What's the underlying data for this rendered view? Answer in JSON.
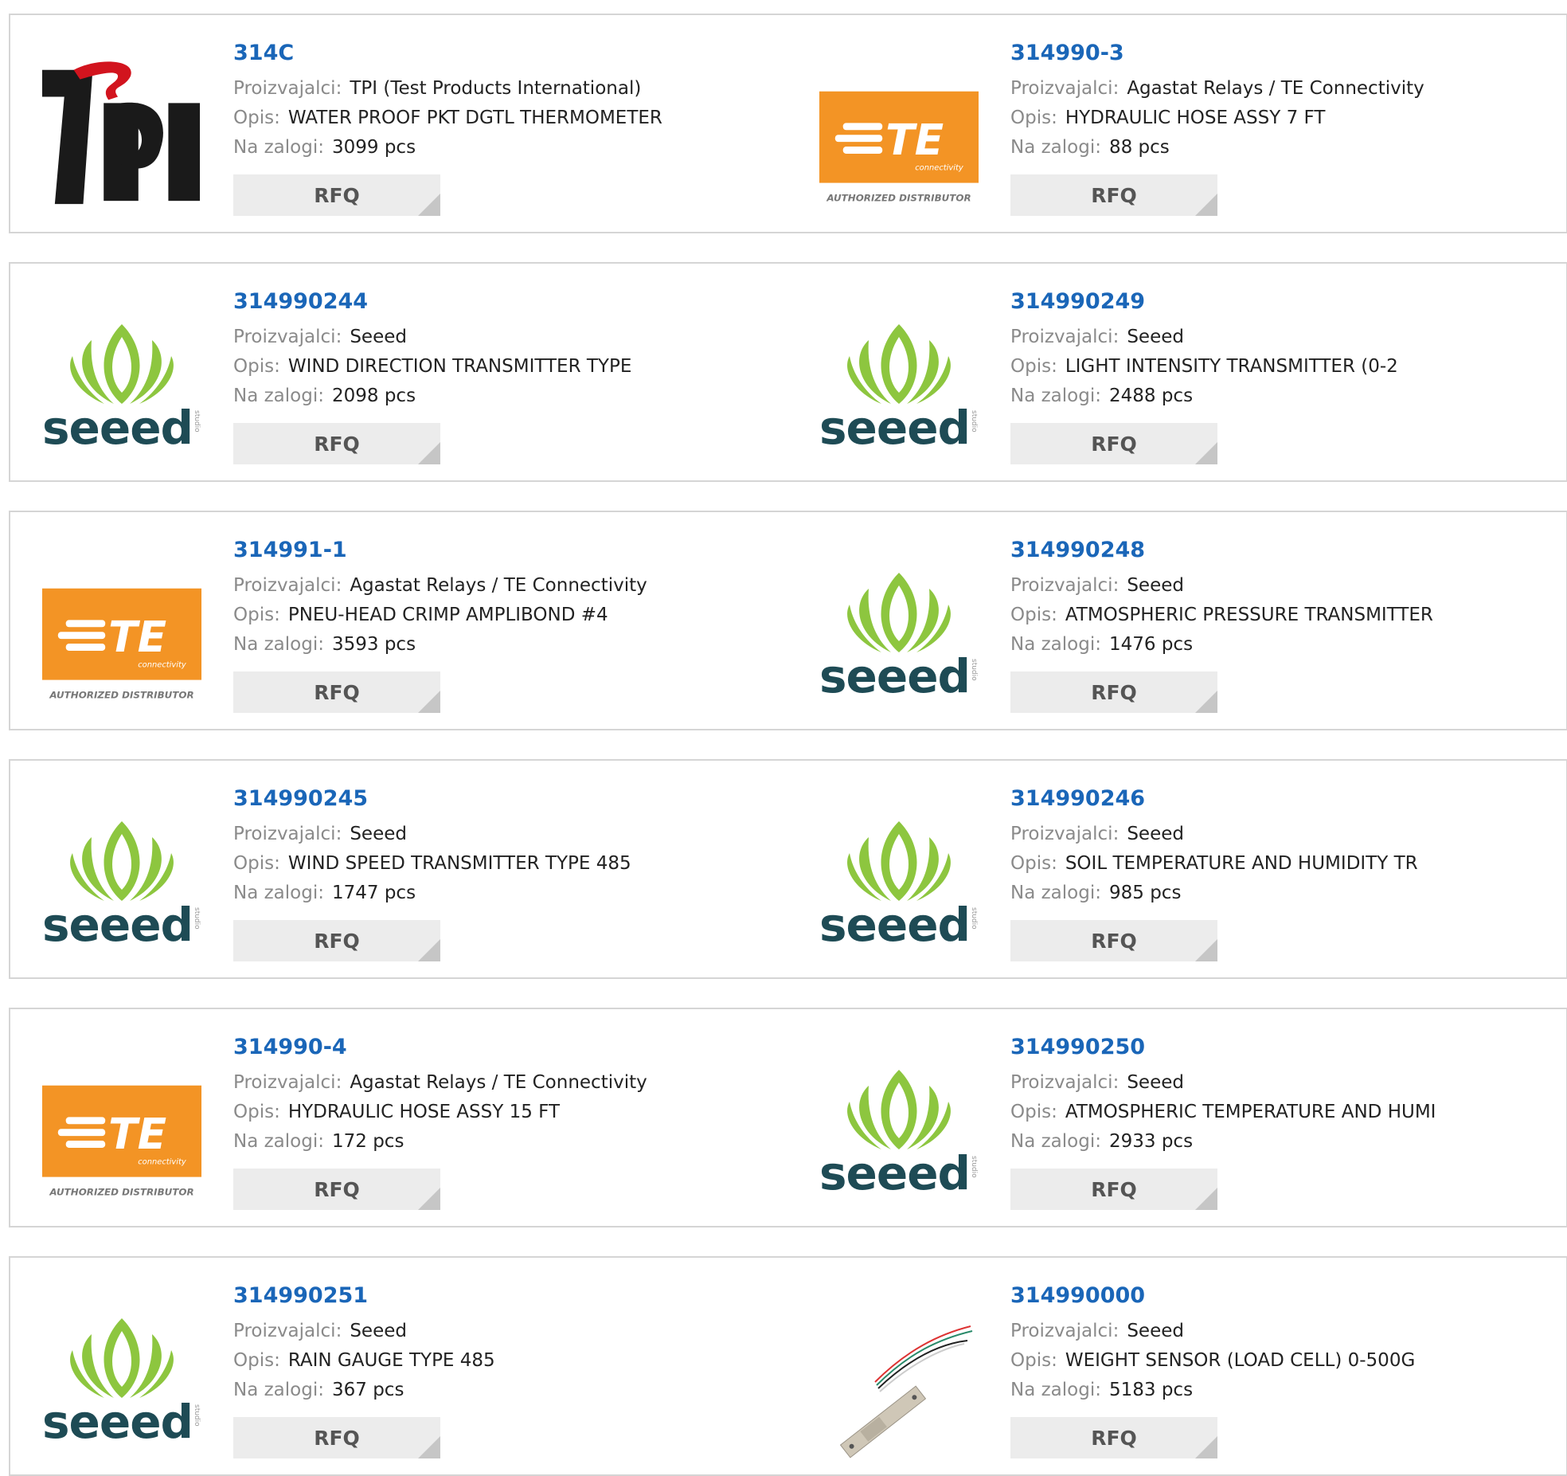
{
  "labels": {
    "manufacturer": "Proizvajalci:",
    "description": "Opis:",
    "stock": "Na zalogi:",
    "rfq": "RFQ"
  },
  "brand_logos": {
    "te_caption": "AUTHORIZED DISTRIBUTOR",
    "te_word": "TE",
    "te_sub": "connectivity",
    "seeed_word": "seeed",
    "seeed_side": "studio",
    "tpi_word": "tpi"
  },
  "colors": {
    "part_link": "#1a66b8",
    "te_orange": "#f39425",
    "seeed_green": "#8dc63f",
    "seeed_text": "#1e4b55",
    "tpi_red": "#d2141e",
    "tpi_black": "#1a1a1a"
  },
  "products": [
    {
      "part": "314C",
      "manufacturer": "TPI (Test Products International)",
      "description": "WATER PROOF PKT DGTL THERMOMETER",
      "stock": "3099 pcs",
      "logo": "tpi-logo"
    },
    {
      "part": "314990-3",
      "manufacturer": "Agastat Relays / TE Connectivity",
      "description": "HYDRAULIC HOSE ASSY 7 FT",
      "stock": "88 pcs",
      "logo": "te-logo"
    },
    {
      "part": "314990244",
      "manufacturer": "Seeed",
      "description": "WIND DIRECTION TRANSMITTER TYPE",
      "stock": "2098 pcs",
      "logo": "seeed-logo"
    },
    {
      "part": "314990249",
      "manufacturer": "Seeed",
      "description": "LIGHT INTENSITY TRANSMITTER (0-2",
      "stock": "2488 pcs",
      "logo": "seeed-logo"
    },
    {
      "part": "314991-1",
      "manufacturer": "Agastat Relays / TE Connectivity",
      "description": "PNEU-HEAD CRIMP AMPLIBOND #4",
      "stock": "3593 pcs",
      "logo": "te-logo"
    },
    {
      "part": "314990248",
      "manufacturer": "Seeed",
      "description": "ATMOSPHERIC PRESSURE TRANSMITTER",
      "stock": "1476 pcs",
      "logo": "seeed-logo"
    },
    {
      "part": "314990245",
      "manufacturer": "Seeed",
      "description": "WIND SPEED TRANSMITTER TYPE 485",
      "stock": "1747 pcs",
      "logo": "seeed-logo"
    },
    {
      "part": "314990246",
      "manufacturer": "Seeed",
      "description": "SOIL TEMPERATURE AND HUMIDITY TR",
      "stock": "985 pcs",
      "logo": "seeed-logo"
    },
    {
      "part": "314990-4",
      "manufacturer": "Agastat Relays / TE Connectivity",
      "description": "HYDRAULIC HOSE ASSY 15 FT",
      "stock": "172 pcs",
      "logo": "te-logo"
    },
    {
      "part": "314990250",
      "manufacturer": "Seeed",
      "description": "ATMOSPHERIC TEMPERATURE AND HUMI",
      "stock": "2933 pcs",
      "logo": "seeed-logo"
    },
    {
      "part": "314990251",
      "manufacturer": "Seeed",
      "description": "RAIN GAUGE TYPE 485",
      "stock": "367 pcs",
      "logo": "seeed-logo"
    },
    {
      "part": "314990000",
      "manufacturer": "Seeed",
      "description": "WEIGHT SENSOR (LOAD CELL) 0-500G",
      "stock": "5183 pcs",
      "logo": "load-cell-photo"
    }
  ]
}
